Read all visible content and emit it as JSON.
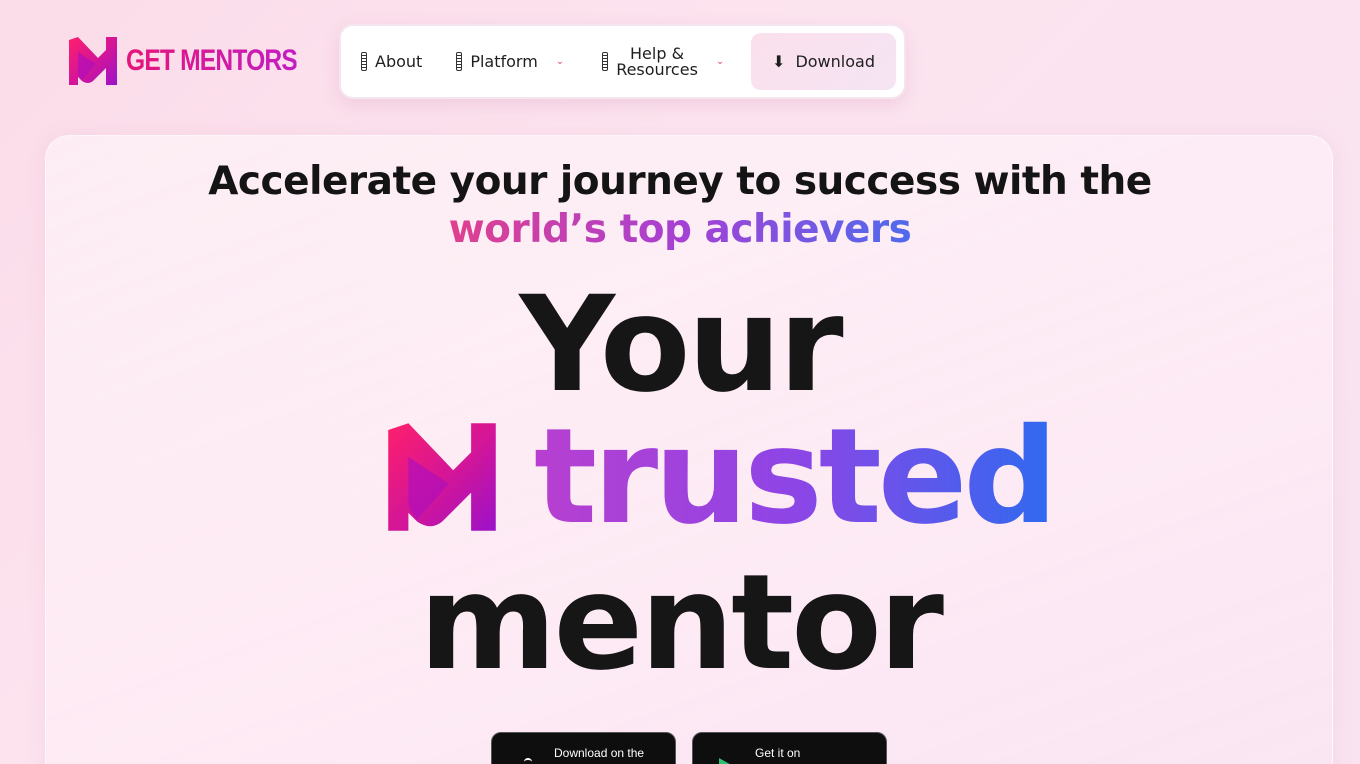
{
  "brand": {
    "name": "GET MENTORS",
    "primary_color": "#e6157a",
    "accent_color": "#c21ec4"
  },
  "nav": {
    "items": [
      {
        "label": "About",
        "icon": "bar-icon"
      },
      {
        "label": "Platform",
        "icon": "bar-icon",
        "has_dropdown": true
      },
      {
        "label_line1": "Help &",
        "label_line2": "Resources",
        "icon": "bar-icon",
        "has_dropdown": true
      }
    ],
    "download_label": "Download",
    "download_icon": "download-arrow-icon",
    "chevron_glyph": "⌄"
  },
  "hero": {
    "subhead_line1": "Accelerate your journey to success with the",
    "subhead_line2": "world’s top achievers",
    "headline_word1": "Your",
    "headline_word2": "trusted",
    "headline_word3": "mentor",
    "gradient_colors": [
      "#e0408e",
      "#a640d4",
      "#4e6bee"
    ]
  },
  "store_buttons": {
    "apple_caption": "Download on the",
    "google_caption": "Get it on"
  }
}
